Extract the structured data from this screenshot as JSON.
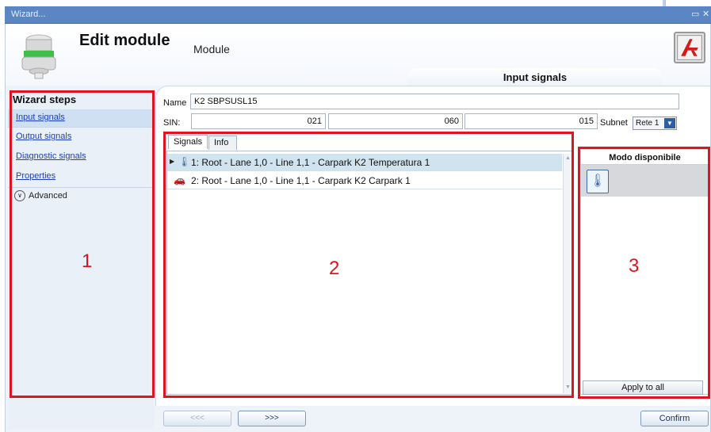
{
  "window": {
    "title": "Wizard..."
  },
  "header": {
    "title": "Edit module",
    "subtitle": "Module"
  },
  "sidebar": {
    "title": "Wizard steps",
    "items": [
      {
        "label": "Input signals"
      },
      {
        "label": "Output signals"
      },
      {
        "label": "Diagnostic signals"
      },
      {
        "label": "Properties"
      }
    ],
    "advanced_label": "Advanced"
  },
  "step_banner": "Input signals",
  "form": {
    "name_label": "Name",
    "name_value": "K2 SBPSUSL15",
    "sin_label": "SIN:",
    "sin_values": [
      "021",
      "060",
      "015"
    ],
    "subnet_label": "Subnet",
    "subnet_value": "Rete 1"
  },
  "tabs": [
    "Signals",
    "Info"
  ],
  "signals": [
    {
      "text": "1: Root - Lane 1,0 - Line 1,1 - Carpark K2 Temperatura 1",
      "icon": "thermometer-icon",
      "selected": true
    },
    {
      "text": "2: Root - Lane 1,0 - Line 1,1 - Carpark K2 Carpark 1",
      "icon": "car-icon",
      "selected": false
    }
  ],
  "mode_panel": {
    "title": "Modo disponibile",
    "apply_label": "Apply to all"
  },
  "annotations": [
    "1",
    "2",
    "3"
  ],
  "nav": {
    "prev_label": "<<<",
    "next_label": ">>>",
    "confirm_label": "Confirm"
  },
  "colors": {
    "accent": "#5b86c4",
    "annotation_red": "#e0141c",
    "selection": "#cfe4ef"
  }
}
